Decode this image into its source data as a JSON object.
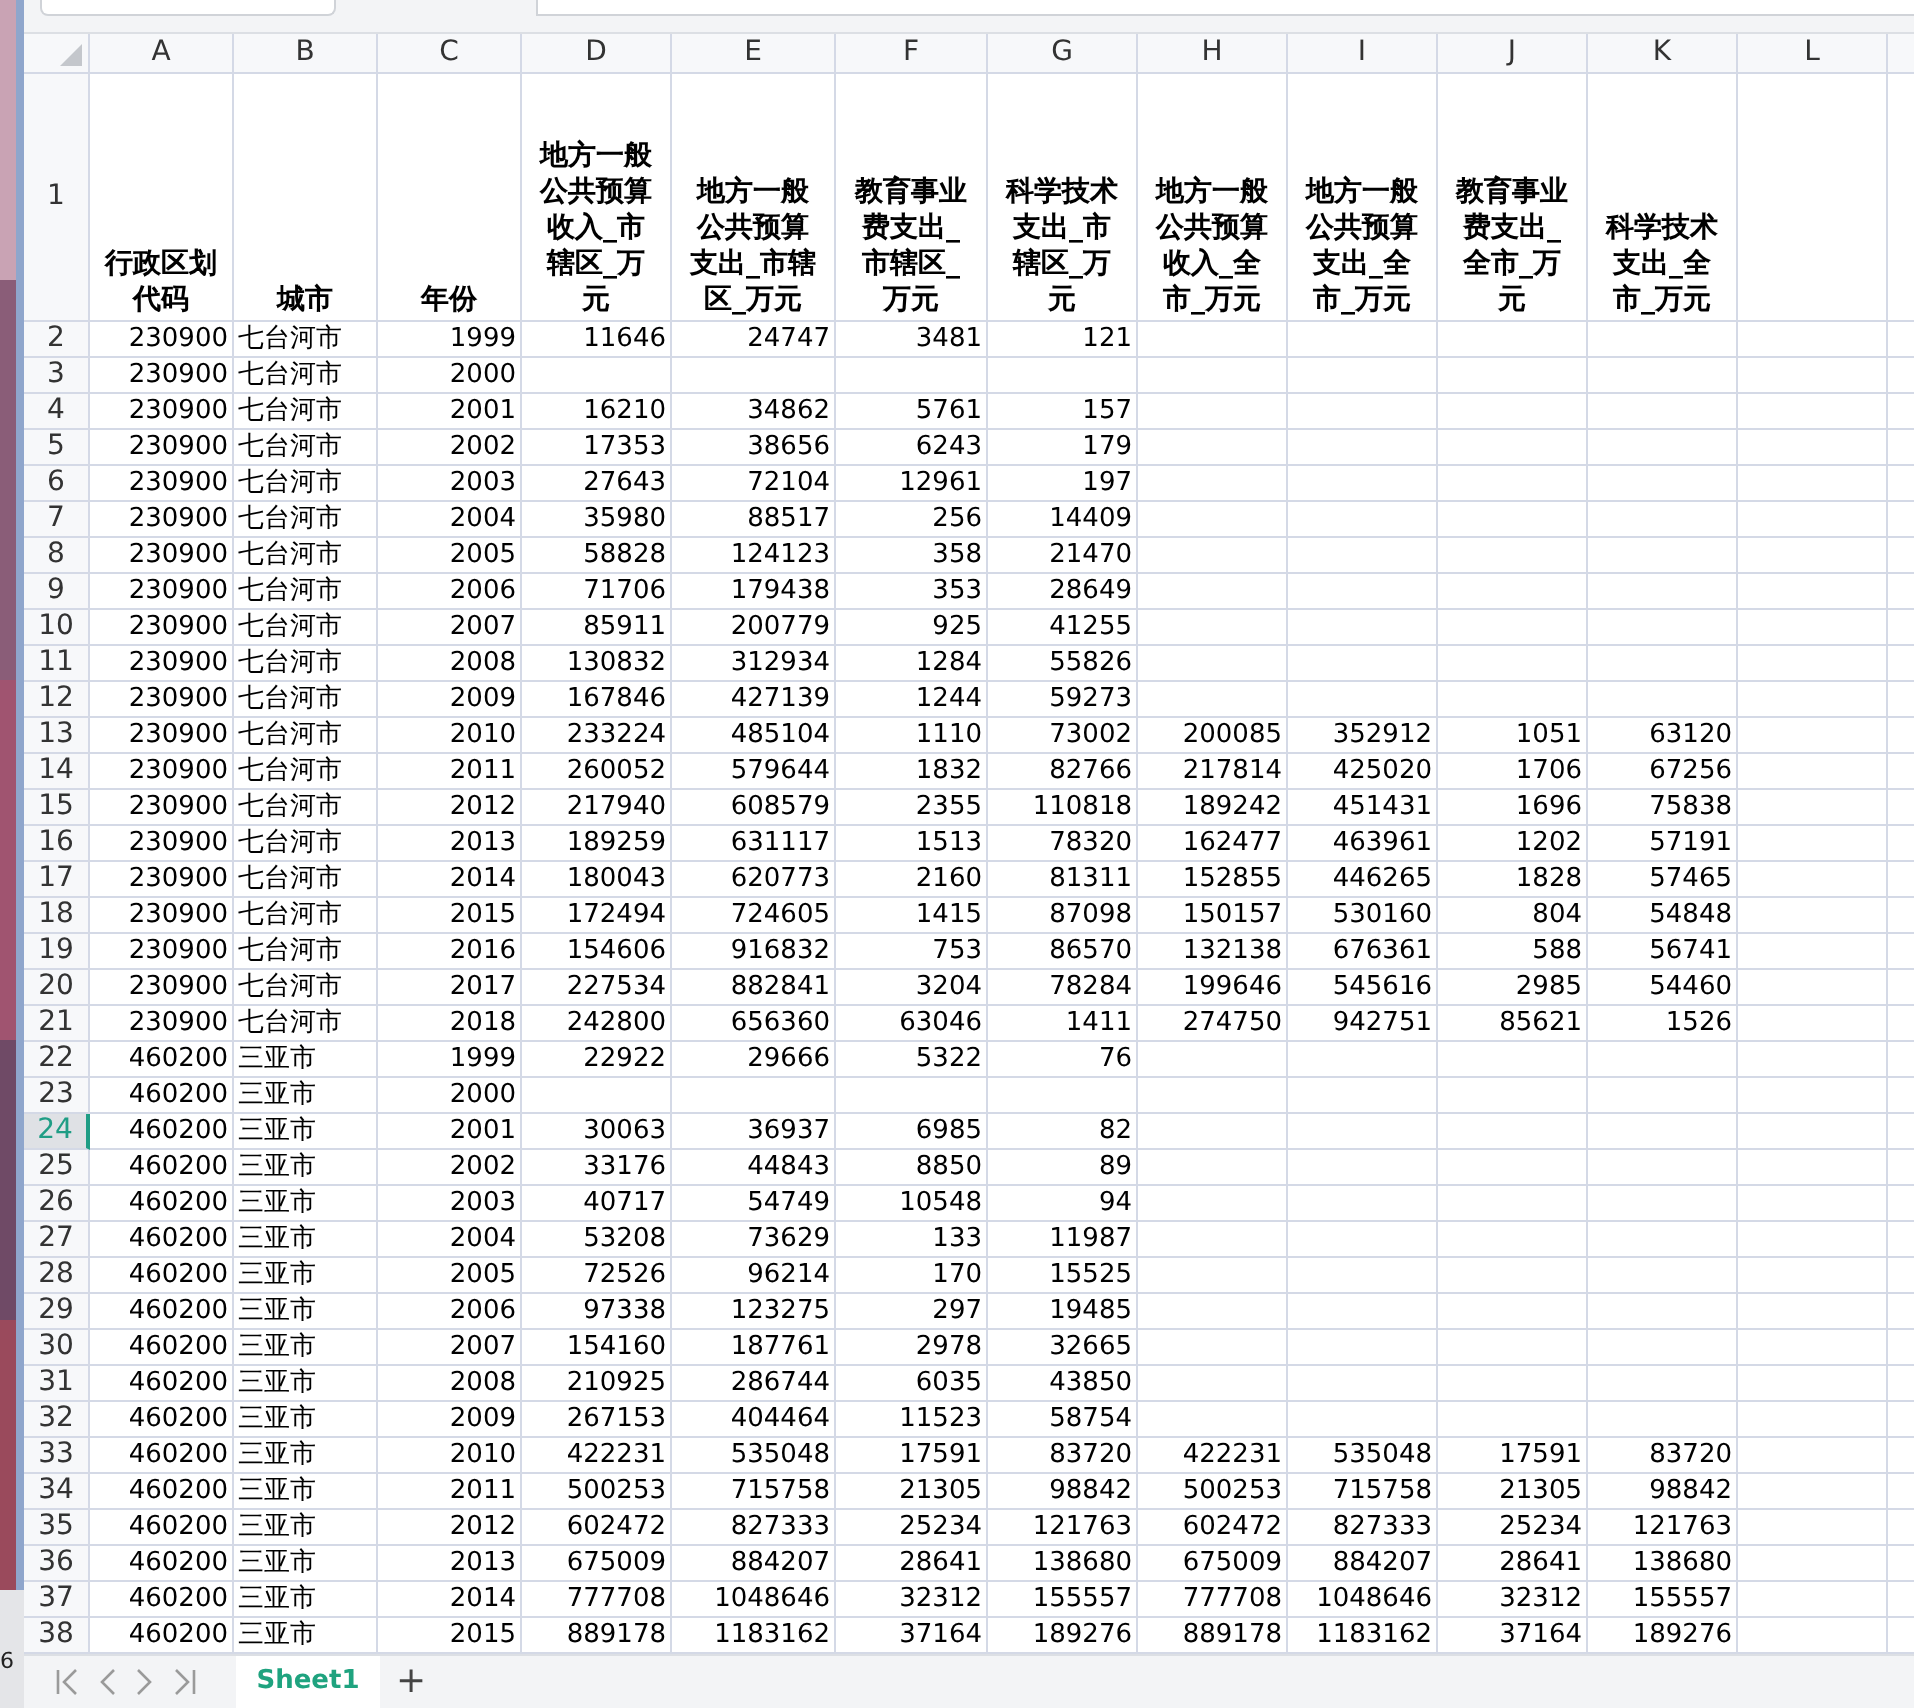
{
  "edge_text": "6",
  "columns": [
    "A",
    "B",
    "C",
    "D",
    "E",
    "F",
    "G",
    "H",
    "I",
    "J",
    "K",
    "L"
  ],
  "header_row": {
    "row": "1",
    "selected": false,
    "cells": [
      "行政区划代码",
      "城市",
      "年份",
      "地方一般公共预算收入_市辖区_万元",
      "地方一般公共预算支出_市辖区_万元",
      "教育事业费支出_市辖区_万元",
      "科学技术支出_市辖区_万元",
      "地方一般公共预算收入_全市_万元",
      "地方一般公共预算支出_全市_万元",
      "教育事业费支出_全市_万元",
      "科学技术支出_全市_万元"
    ]
  },
  "rows": [
    {
      "row": "2",
      "selected": false,
      "cells": [
        "230900",
        "七台河市",
        "1999",
        "11646",
        "24747",
        "3481",
        "121",
        null,
        null,
        null,
        null
      ]
    },
    {
      "row": "3",
      "selected": false,
      "cells": [
        "230900",
        "七台河市",
        "2000",
        null,
        null,
        null,
        null,
        null,
        null,
        null,
        null
      ]
    },
    {
      "row": "4",
      "selected": false,
      "cells": [
        "230900",
        "七台河市",
        "2001",
        "16210",
        "34862",
        "5761",
        "157",
        null,
        null,
        null,
        null
      ]
    },
    {
      "row": "5",
      "selected": false,
      "cells": [
        "230900",
        "七台河市",
        "2002",
        "17353",
        "38656",
        "6243",
        "179",
        null,
        null,
        null,
        null
      ]
    },
    {
      "row": "6",
      "selected": false,
      "cells": [
        "230900",
        "七台河市",
        "2003",
        "27643",
        "72104",
        "12961",
        "197",
        null,
        null,
        null,
        null
      ]
    },
    {
      "row": "7",
      "selected": false,
      "cells": [
        "230900",
        "七台河市",
        "2004",
        "35980",
        "88517",
        "256",
        "14409",
        null,
        null,
        null,
        null
      ]
    },
    {
      "row": "8",
      "selected": false,
      "cells": [
        "230900",
        "七台河市",
        "2005",
        "58828",
        "124123",
        "358",
        "21470",
        null,
        null,
        null,
        null
      ]
    },
    {
      "row": "9",
      "selected": false,
      "cells": [
        "230900",
        "七台河市",
        "2006",
        "71706",
        "179438",
        "353",
        "28649",
        null,
        null,
        null,
        null
      ]
    },
    {
      "row": "10",
      "selected": false,
      "cells": [
        "230900",
        "七台河市",
        "2007",
        "85911",
        "200779",
        "925",
        "41255",
        null,
        null,
        null,
        null
      ]
    },
    {
      "row": "11",
      "selected": false,
      "cells": [
        "230900",
        "七台河市",
        "2008",
        "130832",
        "312934",
        "1284",
        "55826",
        null,
        null,
        null,
        null
      ]
    },
    {
      "row": "12",
      "selected": false,
      "cells": [
        "230900",
        "七台河市",
        "2009",
        "167846",
        "427139",
        "1244",
        "59273",
        null,
        null,
        null,
        null
      ]
    },
    {
      "row": "13",
      "selected": false,
      "cells": [
        "230900",
        "七台河市",
        "2010",
        "233224",
        "485104",
        "1110",
        "73002",
        "200085",
        "352912",
        "1051",
        "63120"
      ]
    },
    {
      "row": "14",
      "selected": false,
      "cells": [
        "230900",
        "七台河市",
        "2011",
        "260052",
        "579644",
        "1832",
        "82766",
        "217814",
        "425020",
        "1706",
        "67256"
      ]
    },
    {
      "row": "15",
      "selected": false,
      "cells": [
        "230900",
        "七台河市",
        "2012",
        "217940",
        "608579",
        "2355",
        "110818",
        "189242",
        "451431",
        "1696",
        "75838"
      ]
    },
    {
      "row": "16",
      "selected": false,
      "cells": [
        "230900",
        "七台河市",
        "2013",
        "189259",
        "631117",
        "1513",
        "78320",
        "162477",
        "463961",
        "1202",
        "57191"
      ]
    },
    {
      "row": "17",
      "selected": false,
      "cells": [
        "230900",
        "七台河市",
        "2014",
        "180043",
        "620773",
        "2160",
        "81311",
        "152855",
        "446265",
        "1828",
        "57465"
      ]
    },
    {
      "row": "18",
      "selected": false,
      "cells": [
        "230900",
        "七台河市",
        "2015",
        "172494",
        "724605",
        "1415",
        "87098",
        "150157",
        "530160",
        "804",
        "54848"
      ]
    },
    {
      "row": "19",
      "selected": false,
      "cells": [
        "230900",
        "七台河市",
        "2016",
        "154606",
        "916832",
        "753",
        "86570",
        "132138",
        "676361",
        "588",
        "56741"
      ]
    },
    {
      "row": "20",
      "selected": false,
      "cells": [
        "230900",
        "七台河市",
        "2017",
        "227534",
        "882841",
        "3204",
        "78284",
        "199646",
        "545616",
        "2985",
        "54460"
      ]
    },
    {
      "row": "21",
      "selected": false,
      "cells": [
        "230900",
        "七台河市",
        "2018",
        "242800",
        "656360",
        "63046",
        "1411",
        "274750",
        "942751",
        "85621",
        "1526"
      ]
    },
    {
      "row": "22",
      "selected": false,
      "cells": [
        "460200",
        "三亚市",
        "1999",
        "22922",
        "29666",
        "5322",
        "76",
        null,
        null,
        null,
        null
      ]
    },
    {
      "row": "23",
      "selected": false,
      "cells": [
        "460200",
        "三亚市",
        "2000",
        null,
        null,
        null,
        null,
        null,
        null,
        null,
        null
      ]
    },
    {
      "row": "24",
      "selected": true,
      "cells": [
        "460200",
        "三亚市",
        "2001",
        "30063",
        "36937",
        "6985",
        "82",
        null,
        null,
        null,
        null
      ]
    },
    {
      "row": "25",
      "selected": false,
      "cells": [
        "460200",
        "三亚市",
        "2002",
        "33176",
        "44843",
        "8850",
        "89",
        null,
        null,
        null,
        null
      ]
    },
    {
      "row": "26",
      "selected": false,
      "cells": [
        "460200",
        "三亚市",
        "2003",
        "40717",
        "54749",
        "10548",
        "94",
        null,
        null,
        null,
        null
      ]
    },
    {
      "row": "27",
      "selected": false,
      "cells": [
        "460200",
        "三亚市",
        "2004",
        "53208",
        "73629",
        "133",
        "11987",
        null,
        null,
        null,
        null
      ]
    },
    {
      "row": "28",
      "selected": false,
      "cells": [
        "460200",
        "三亚市",
        "2005",
        "72526",
        "96214",
        "170",
        "15525",
        null,
        null,
        null,
        null
      ]
    },
    {
      "row": "29",
      "selected": false,
      "cells": [
        "460200",
        "三亚市",
        "2006",
        "97338",
        "123275",
        "297",
        "19485",
        null,
        null,
        null,
        null
      ]
    },
    {
      "row": "30",
      "selected": false,
      "cells": [
        "460200",
        "三亚市",
        "2007",
        "154160",
        "187761",
        "2978",
        "32665",
        null,
        null,
        null,
        null
      ]
    },
    {
      "row": "31",
      "selected": false,
      "cells": [
        "460200",
        "三亚市",
        "2008",
        "210925",
        "286744",
        "6035",
        "43850",
        null,
        null,
        null,
        null
      ]
    },
    {
      "row": "32",
      "selected": false,
      "cells": [
        "460200",
        "三亚市",
        "2009",
        "267153",
        "404464",
        "11523",
        "58754",
        null,
        null,
        null,
        null
      ]
    },
    {
      "row": "33",
      "selected": false,
      "cells": [
        "460200",
        "三亚市",
        "2010",
        "422231",
        "535048",
        "17591",
        "83720",
        "422231",
        "535048",
        "17591",
        "83720"
      ]
    },
    {
      "row": "34",
      "selected": false,
      "cells": [
        "460200",
        "三亚市",
        "2011",
        "500253",
        "715758",
        "21305",
        "98842",
        "500253",
        "715758",
        "21305",
        "98842"
      ]
    },
    {
      "row": "35",
      "selected": false,
      "cells": [
        "460200",
        "三亚市",
        "2012",
        "602472",
        "827333",
        "25234",
        "121763",
        "602472",
        "827333",
        "25234",
        "121763"
      ]
    },
    {
      "row": "36",
      "selected": false,
      "cells": [
        "460200",
        "三亚市",
        "2013",
        "675009",
        "884207",
        "28641",
        "138680",
        "675009",
        "884207",
        "28641",
        "138680"
      ]
    },
    {
      "row": "37",
      "selected": false,
      "cells": [
        "460200",
        "三亚市",
        "2014",
        "777708",
        "1048646",
        "32312",
        "155557",
        "777708",
        "1048646",
        "32312",
        "155557"
      ]
    },
    {
      "row": "38",
      "selected": false,
      "cells": [
        "460200",
        "三亚市",
        "2015",
        "889178",
        "1183162",
        "37164",
        "189276",
        "889178",
        "1183162",
        "37164",
        "189276"
      ]
    }
  ],
  "sheet_tabs": [
    {
      "label": "Sheet1",
      "selected": true
    }
  ],
  "add_sheet": "+"
}
